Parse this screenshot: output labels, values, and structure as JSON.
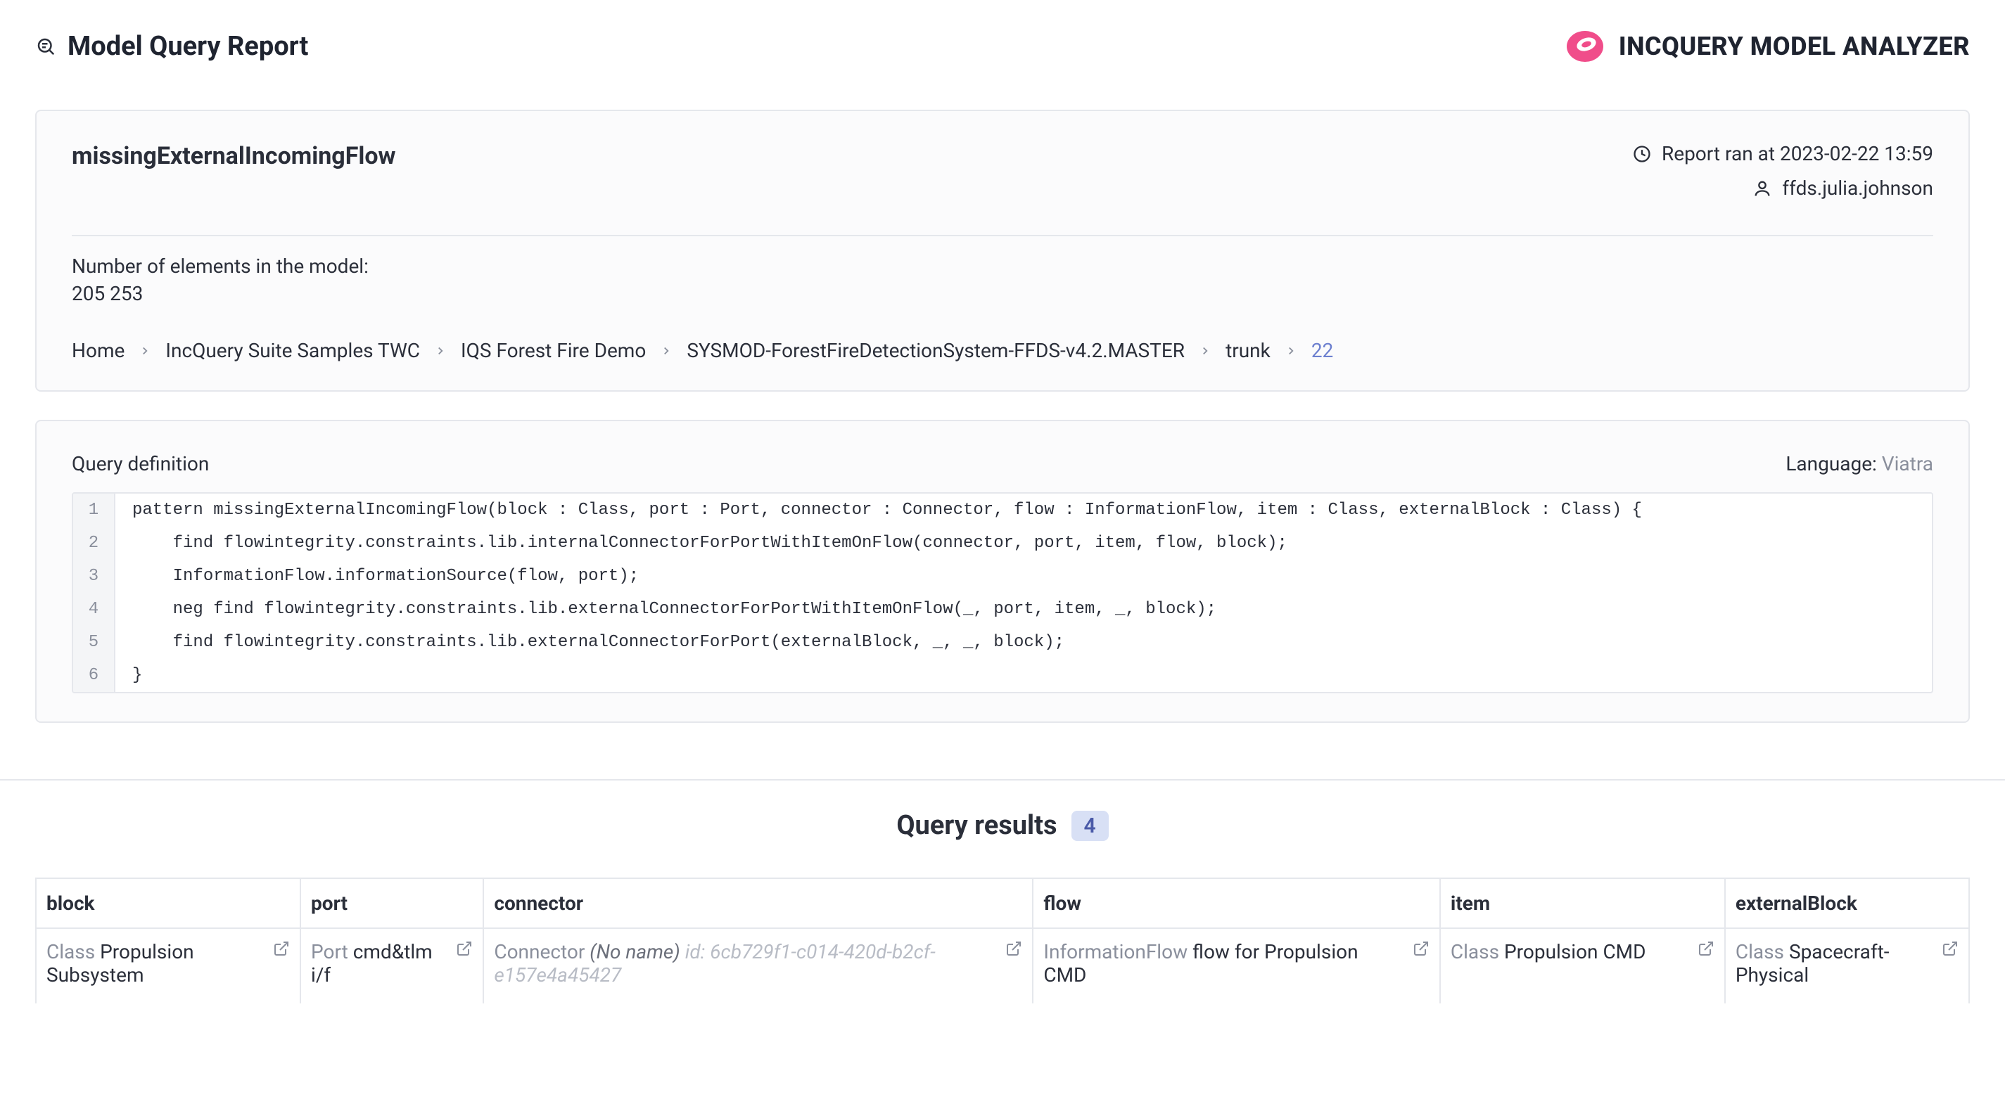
{
  "header": {
    "title": "Model Query Report",
    "brand": "INCQUERY MODEL ANALYZER"
  },
  "report": {
    "query_name": "missingExternalIncomingFlow",
    "timestamp_label": "Report ran at 2023-02-22 13:59",
    "user": "ffds.julia.johnson",
    "count_label": "Number of elements in the model:",
    "count_value": "205 253"
  },
  "breadcrumb": [
    "Home",
    "IncQuery Suite Samples TWC",
    "IQS Forest Fire Demo",
    "SYSMOD-ForestFireDetectionSystem-FFDS-v4.2.MASTER",
    "trunk",
    "22"
  ],
  "definition": {
    "section_title": "Query definition",
    "language_label": "Language: ",
    "language_value": "Viatra",
    "lines": [
      "pattern missingExternalIncomingFlow(block : Class, port : Port, connector : Connector, flow : InformationFlow, item : Class, externalBlock : Class) {",
      "    find flowintegrity.constraints.lib.internalConnectorForPortWithItemOnFlow(connector, port, item, flow, block);",
      "    InformationFlow.informationSource(flow, port);",
      "    neg find flowintegrity.constraints.lib.externalConnectorForPortWithItemOnFlow(_, port, item, _, block);",
      "    find flowintegrity.constraints.lib.externalConnectorForPort(externalBlock, _, _, block);",
      "}"
    ]
  },
  "results": {
    "title": "Query results",
    "count": "4",
    "columns": [
      "block",
      "port",
      "connector",
      "flow",
      "item",
      "externalBlock"
    ],
    "col_widths": [
      "13%",
      "9%",
      "27%",
      "20%",
      "14%",
      "12%"
    ],
    "rows": [
      {
        "block": {
          "type": "Class",
          "name": "Propulsion Subsystem"
        },
        "port": {
          "type": "Port",
          "name": "cmd&tlm i/f"
        },
        "connector": {
          "type": "Connector",
          "noname": "(No name)",
          "id": "id: 6cb729f1-c014-420d-b2cf-e157e4a45427"
        },
        "flow": {
          "type": "InformationFlow",
          "name": "flow for Propulsion CMD"
        },
        "item": {
          "type": "Class",
          "name": "Propulsion CMD"
        },
        "externalBlock": {
          "type": "Class",
          "name": "Spacecraft-Physical"
        }
      }
    ]
  }
}
